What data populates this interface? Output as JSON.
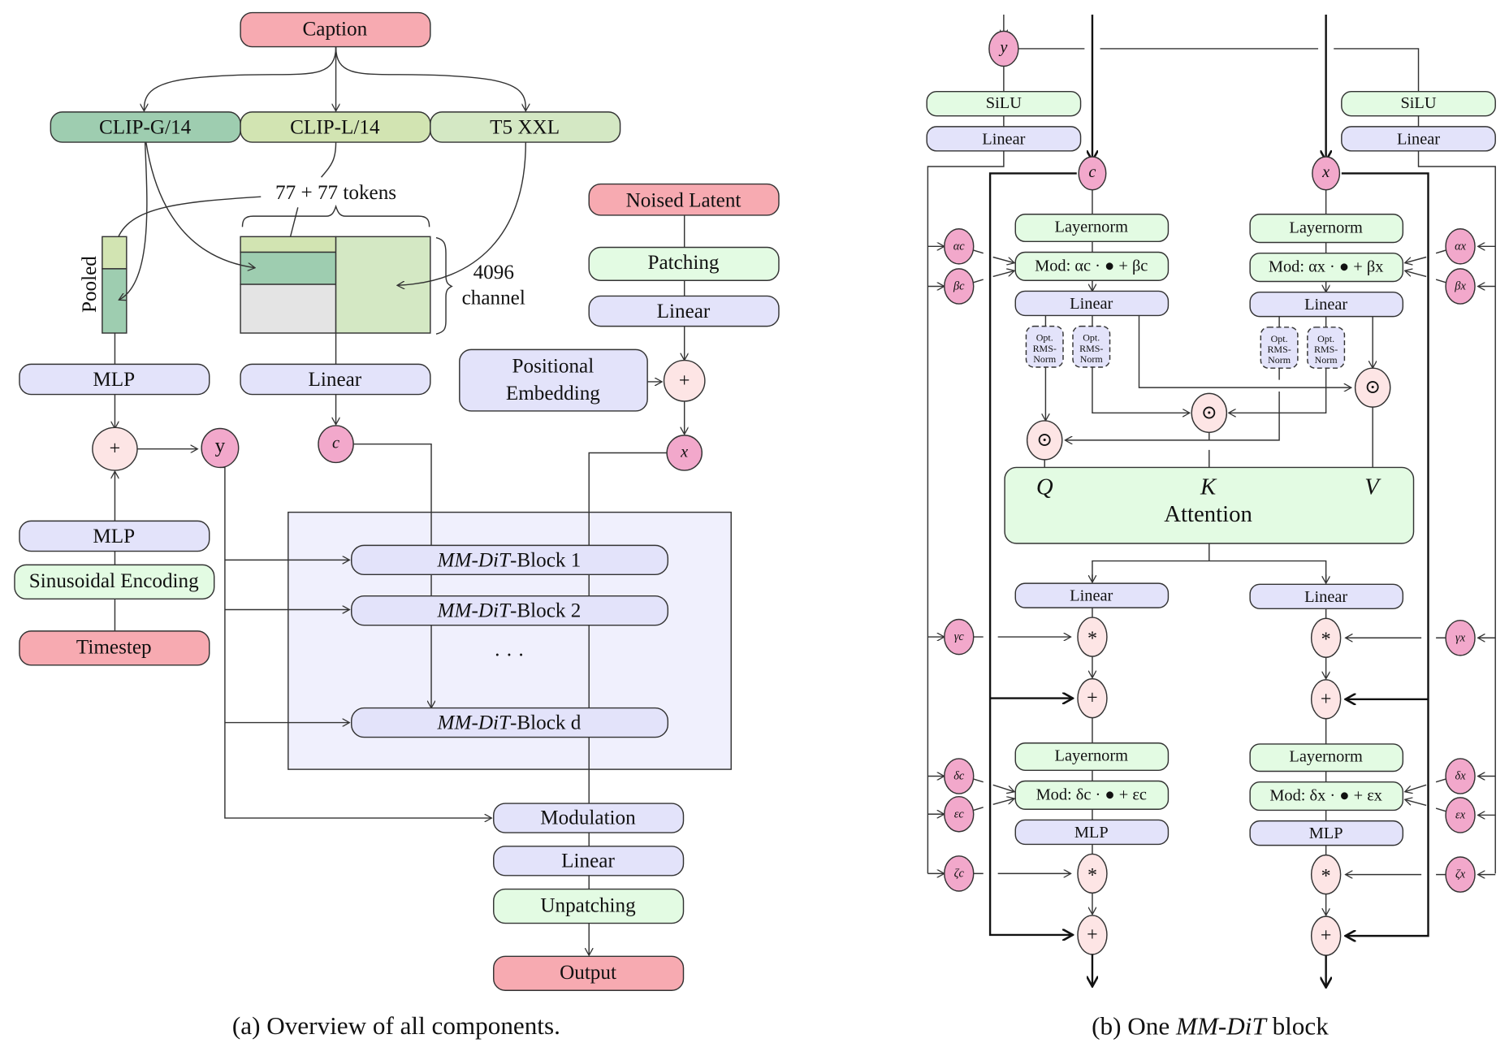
{
  "colors": {
    "input_red": "#f7aab1",
    "clip_g": "#9ecdb0",
    "clip_l": "#d2e4b2",
    "t5": "#d4e8c4",
    "block_lavender": "#e3e3fa",
    "green_light": "#e3fbe3",
    "node_pink": "#f2a8cb",
    "op_pink": "#fde5e5",
    "region_lavender": "#f0f0fd",
    "matrix_gray": "#e4e4e4"
  },
  "panel_a": {
    "caption": "(a) Overview of all components.",
    "caption_box": "Caption",
    "encoders": [
      "CLIP-G/14",
      "CLIP-L/14",
      "T5 XXL"
    ],
    "tokens_label": "77 + 77 tokens",
    "channel_label_1": "4096",
    "channel_label_2": "channel",
    "pooled_label": "Pooled",
    "mlp_top": "MLP",
    "linear_c": "Linear",
    "plus": "+",
    "y_node": "y",
    "c_node": "c",
    "mlp_bottom": "MLP",
    "sinusoidal": "Sinusoidal Encoding",
    "timestep": "Timestep",
    "noised_latent": "Noised Latent",
    "patching": "Patching",
    "linear_x": "Linear",
    "positional_1": "Positional",
    "positional_2": "Embedding",
    "x_node": "x",
    "blocks": [
      {
        "prefix": "MM-DiT",
        "suffix": "-Block 1"
      },
      {
        "prefix": "MM-DiT",
        "suffix": "-Block 2"
      },
      {
        "prefix": "MM-DiT",
        "suffix": "-Block d"
      }
    ],
    "ellipsis": "· · ·",
    "modulation": "Modulation",
    "linear_out": "Linear",
    "unpatching": "Unpatching",
    "output": "Output"
  },
  "panel_b": {
    "caption_pre": "(b) One ",
    "caption_em": "MM-DiT",
    "caption_post": " block",
    "y_node": "y",
    "c_node": "c",
    "x_node": "x",
    "silu": "SiLU",
    "linear": "Linear",
    "layernorm": "Layernorm",
    "mod_c_1": "Mod: αc · ● + βc",
    "mod_x_1": "Mod: αx · ● + βx",
    "mod_c_2": "Mod: δc · ● + εc",
    "mod_x_2": "Mod: δx · ● + εx",
    "rmsnorm": [
      "Opt.",
      "RMS-",
      "Norm"
    ],
    "odot": "⊙",
    "Q": "Q",
    "K": "K",
    "V": "V",
    "attention": "Attention",
    "mlp": "MLP",
    "star": "*",
    "plus": "+",
    "params_c": [
      "αc",
      "βc",
      "γc",
      "δc",
      "εc",
      "ζc"
    ],
    "params_x": [
      "αx",
      "βx",
      "γx",
      "δx",
      "εx",
      "ζx"
    ]
  }
}
